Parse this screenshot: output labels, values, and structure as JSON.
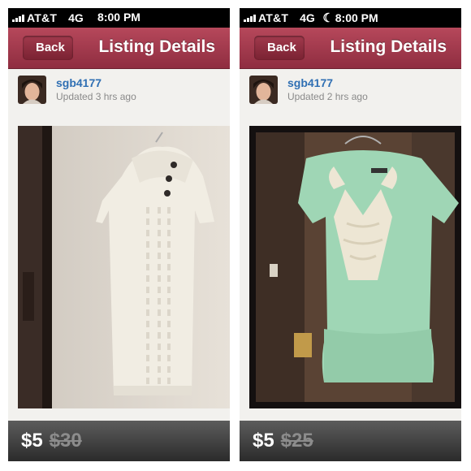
{
  "screens": [
    {
      "status": {
        "carrier": "AT&T",
        "network": "4G",
        "time": "8:00 PM"
      },
      "nav": {
        "back_label": "Back",
        "title": "Listing Details"
      },
      "user": {
        "username": "sgb4177",
        "updated": "Updated 3 hrs ago"
      },
      "photo": {
        "subject": "white cable-knit sweater dress with buttons on hanger"
      },
      "price": {
        "current": "$5",
        "original": "$30"
      }
    },
    {
      "status": {
        "carrier": "AT&T",
        "network": "4G",
        "time": "8:00 PM",
        "moon_icon": "moon-icon"
      },
      "nav": {
        "back_label": "Back",
        "title": "Listing Details"
      },
      "user": {
        "username": "sgb4177",
        "updated": "Updated 2 hrs ago"
      },
      "photo": {
        "subject": "mint green top with white lace front on hanger"
      },
      "price": {
        "current": "$5",
        "original": "$25"
      }
    }
  ],
  "colors": {
    "navbar": "#a33b4e",
    "username": "#2f6fb3",
    "pricebar": "#3a3a3a"
  }
}
